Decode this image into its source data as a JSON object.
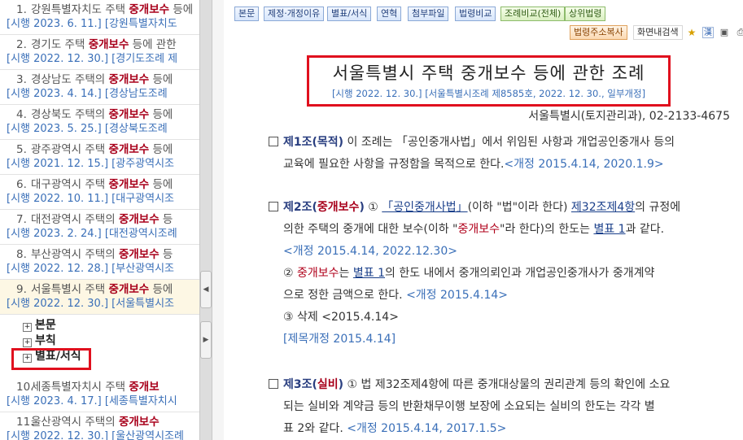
{
  "left_panel": {
    "items": [
      {
        "num": "1.",
        "prefix": "강원특별자치도 주택 ",
        "keyword": "중개보수",
        "suffix": " 등에",
        "sub": "[시행 2023. 6. 11.] [강원특별자치도"
      },
      {
        "num": "2.",
        "prefix": "경기도 주택 ",
        "keyword": "중개보수",
        "suffix": " 등에 관한",
        "sub": "[시행 2022. 12. 30.] [경기도조례 제"
      },
      {
        "num": "3.",
        "prefix": "경상남도 주택의 ",
        "keyword": "중개보수",
        "suffix": " 등에",
        "sub": "[시행 2023. 4. 14.] [경상남도조례"
      },
      {
        "num": "4.",
        "prefix": "경상북도 주택의 ",
        "keyword": "중개보수",
        "suffix": " 등에",
        "sub": "[시행 2023. 5. 25.] [경상북도조례"
      },
      {
        "num": "5.",
        "prefix": "광주광역시 주택 ",
        "keyword": "중개보수",
        "suffix": " 등에",
        "sub": "[시행 2021. 12. 15.] [광주광역시조"
      },
      {
        "num": "6.",
        "prefix": "대구광역시 주택 ",
        "keyword": "중개보수",
        "suffix": " 등에",
        "sub": "[시행 2022. 10. 11.] [대구광역시조"
      },
      {
        "num": "7.",
        "prefix": "대전광역시 주택의 ",
        "keyword": "중개보수",
        "suffix": " 등",
        "sub": "[시행 2023. 2. 24.] [대전광역시조례"
      },
      {
        "num": "8.",
        "prefix": "부산광역시 주택의 ",
        "keyword": "중개보수",
        "suffix": " 등",
        "sub": "[시행 2022. 12. 28.] [부산광역시조"
      },
      {
        "num": "9.",
        "prefix": "서울특별시 주택 ",
        "keyword": "중개보수",
        "suffix": " 등에",
        "sub": "[시행 2022. 12. 30.] [서울특별시조"
      },
      {
        "num": "10.",
        "prefix": "세종특별자치시 주택 ",
        "keyword": "중개보",
        "suffix": "",
        "sub": "[시행 2023. 4. 17.] [세종특별자치시"
      },
      {
        "num": "11.",
        "prefix": "울산광역시 주택의 ",
        "keyword": "중개보수",
        "suffix": "",
        "sub": "[시행 2022. 12. 30.] [울산광역시조례"
      }
    ],
    "tree": [
      "본문",
      "부칙",
      "별표/서식"
    ]
  },
  "toolbar": {
    "row1": [
      "본문",
      "제정·개정이유",
      "별표/서식",
      "연혁",
      "첨부파일",
      "법령비교",
      "조례비교(전체)",
      "상위법령"
    ],
    "row2": [
      "법령주소복사",
      "화면내검색"
    ]
  },
  "document": {
    "title": "서울특별시 주택 중개보수 등에 관한 조례",
    "subtitle": "[시행 2022. 12. 30.] [서울특별시조례 제8585호, 2022. 12. 30., 일부개정]",
    "dept": "서울특별시(토지관리과), 02-2133-4675",
    "art1": {
      "head": "제1조(목적)",
      "text1": " 이 조례는 「공인중개사법」에서 위임된 사항과 개업공인중개사 등의",
      "text2": "교육에 필요한 사항을 규정함을 목적으로 한다.",
      "amend": "<개정 2015.4.14, 2020.1.9>"
    },
    "art2": {
      "head_a": "제2조(",
      "head_b": "중개보수",
      "head_c": ")",
      "p1_num": " ① ",
      "p1_link1": "「공인중개사법」",
      "p1_t1": "(이하 \"법\"이라 한다) ",
      "p1_link2": "제32조제4항",
      "p1_t2": "의 규정에",
      "p1_line2a": "의한 주택의 중개에 대한 보수(이하 \"",
      "p1_line2b": "중개보수",
      "p1_line2c": "\"라 한다)의 한도는 ",
      "p1_link3": "별표 1",
      "p1_line2d": "과 같다.",
      "p1_amend": "<개정 2015.4.14, 2022.12.30>",
      "p2_num": "② ",
      "p2_kw": "중개보수",
      "p2_t1": "는 ",
      "p2_link": "별표 1",
      "p2_t2": "의 한도 내에서 중개의뢰인과 개업공인중개사가 중개계약",
      "p2_line2": "으로 정한 금액으로 한다. ",
      "p2_amend": "<개정 2015.4.14>",
      "p3": "③ 삭제 <2015.4.14>",
      "title_amend": "[제목개정 2015.4.14]"
    },
    "art3": {
      "head_a": "제3조(",
      "head_b": "실비",
      "head_c": ")",
      "text1": " ① 법 제32조제4항에 따른 중개대상물의 권리관계 등의 확인에 소요",
      "text2": "되는 실비와 계약금 등의 반환채무이행 보장에 소요되는 실비의 한도는 각각 별",
      "text3": "표 2와 같다. ",
      "amend": "<개정 2015.4.14, 2017.1.5>"
    }
  },
  "colors": {
    "keyword": "#a8001b",
    "link_blue": "#3a6fb8",
    "highlight_box": "#e0101e"
  }
}
